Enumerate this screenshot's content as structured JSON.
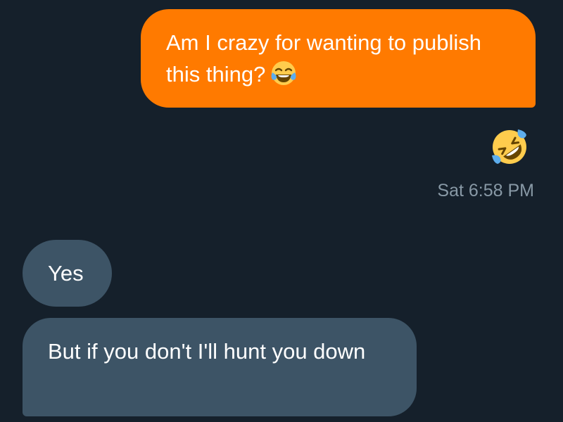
{
  "messages": {
    "sent": {
      "text": "Am I crazy for wanting to publish this thing?",
      "emoji_icon": "face-with-tears-of-joy-icon"
    },
    "reaction_icon": "rolling-on-the-floor-laughing-icon",
    "timestamp": "Sat 6:58 PM",
    "received": [
      {
        "text": "Yes"
      },
      {
        "text": "But if you don't I'll hunt you down"
      }
    ]
  },
  "colors": {
    "background": "#15202b",
    "sent_bubble": "#ff7a00",
    "received_bubble": "#3d5466",
    "timestamp": "#8899a6"
  }
}
